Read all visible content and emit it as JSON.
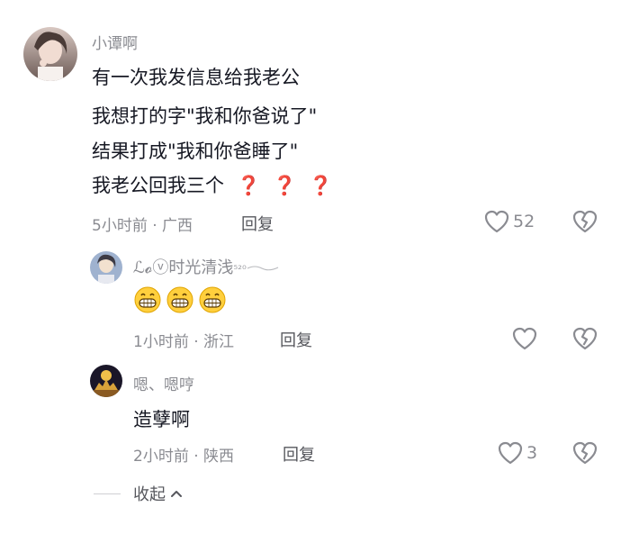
{
  "comments": [
    {
      "username": "小谭啊",
      "lines": [
        "有一次我发信息给我老公",
        "我想打的字\"我和你爸说了\"",
        "结果打成\"我和你爸睡了\"",
        "我老公回我三个"
      ],
      "question_marks": [
        "❓",
        "❓",
        "❓"
      ],
      "time": "5小时前",
      "location": "广西",
      "reply_label": "回复",
      "like_count": "52"
    }
  ],
  "replies": [
    {
      "username": "ℒ𝓸ⓥ时光清浅",
      "username_suffix": "⁵²⁰",
      "content_emojis": [
        "grin-emoji",
        "grin-emoji",
        "grin-emoji"
      ],
      "time": "1小时前",
      "location": "浙江",
      "reply_label": "回复",
      "like_count": ""
    },
    {
      "username": "嗯、嗯哼",
      "text": "造孽啊",
      "time": "2小时前",
      "location": "陕西",
      "reply_label": "回复",
      "like_count": "3"
    }
  ],
  "separator": " · ",
  "collapse_label": "收起",
  "colors": {
    "meta": "#8a8b91",
    "text": "#161823",
    "accent": "#e0212e"
  }
}
